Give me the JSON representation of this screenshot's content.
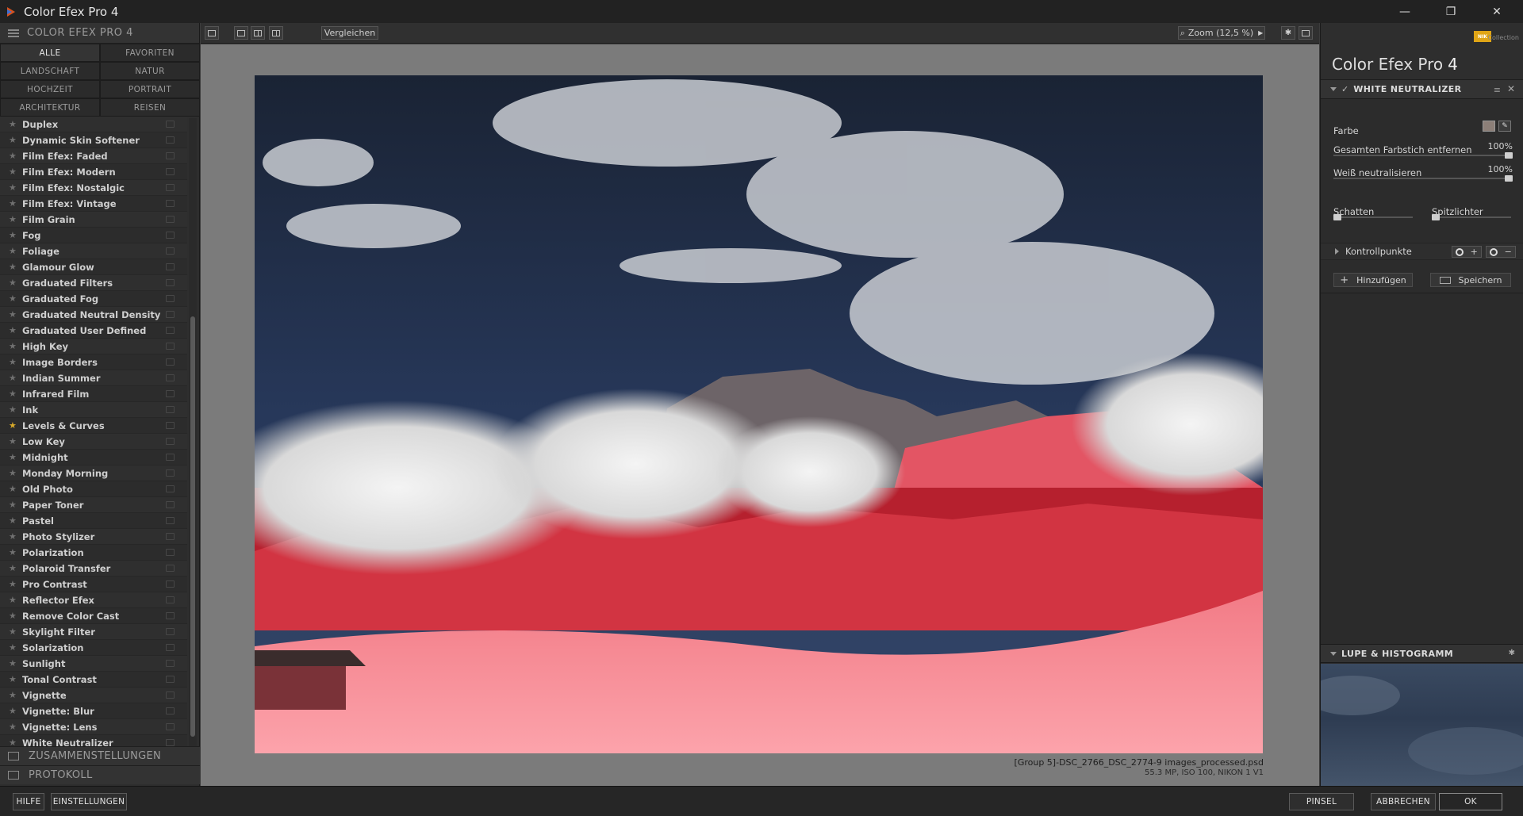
{
  "window": {
    "title": "Color Efex Pro 4",
    "minimize": "—",
    "maximize": "❐",
    "close": "✕"
  },
  "left": {
    "header": "COLOR EFEX PRO 4",
    "categories": [
      {
        "label": "ALLE",
        "active": true
      },
      {
        "label": "FAVORITEN",
        "active": false
      },
      {
        "label": "LANDSCHAFT",
        "active": false
      },
      {
        "label": "NATUR",
        "active": false
      },
      {
        "label": "HOCHZEIT",
        "active": false
      },
      {
        "label": "PORTRAIT",
        "active": false
      },
      {
        "label": "ARCHITEKTUR",
        "active": false
      },
      {
        "label": "REISEN",
        "active": false
      }
    ],
    "filters": [
      {
        "name": "Duplex",
        "fav": false
      },
      {
        "name": "Dynamic Skin Softener",
        "fav": false
      },
      {
        "name": "Film Efex: Faded",
        "fav": false
      },
      {
        "name": "Film Efex: Modern",
        "fav": false
      },
      {
        "name": "Film Efex: Nostalgic",
        "fav": false
      },
      {
        "name": "Film Efex: Vintage",
        "fav": false
      },
      {
        "name": "Film Grain",
        "fav": false
      },
      {
        "name": "Fog",
        "fav": false
      },
      {
        "name": "Foliage",
        "fav": false
      },
      {
        "name": "Glamour Glow",
        "fav": false
      },
      {
        "name": "Graduated Filters",
        "fav": false
      },
      {
        "name": "Graduated Fog",
        "fav": false
      },
      {
        "name": "Graduated Neutral Density",
        "fav": false
      },
      {
        "name": "Graduated User Defined",
        "fav": false
      },
      {
        "name": "High Key",
        "fav": false
      },
      {
        "name": "Image Borders",
        "fav": false
      },
      {
        "name": "Indian Summer",
        "fav": false
      },
      {
        "name": "Infrared Film",
        "fav": false
      },
      {
        "name": "Ink",
        "fav": false
      },
      {
        "name": "Levels & Curves",
        "fav": true
      },
      {
        "name": "Low Key",
        "fav": false
      },
      {
        "name": "Midnight",
        "fav": false
      },
      {
        "name": "Monday Morning",
        "fav": false
      },
      {
        "name": "Old Photo",
        "fav": false
      },
      {
        "name": "Paper Toner",
        "fav": false
      },
      {
        "name": "Pastel",
        "fav": false
      },
      {
        "name": "Photo Stylizer",
        "fav": false
      },
      {
        "name": "Polarization",
        "fav": false
      },
      {
        "name": "Polaroid Transfer",
        "fav": false
      },
      {
        "name": "Pro Contrast",
        "fav": false
      },
      {
        "name": "Reflector Efex",
        "fav": false
      },
      {
        "name": "Remove Color Cast",
        "fav": false
      },
      {
        "name": "Skylight Filter",
        "fav": false
      },
      {
        "name": "Solarization",
        "fav": false
      },
      {
        "name": "Sunlight",
        "fav": false
      },
      {
        "name": "Tonal Contrast",
        "fav": false
      },
      {
        "name": "Vignette",
        "fav": false
      },
      {
        "name": "Vignette: Blur",
        "fav": false
      },
      {
        "name": "Vignette: Lens",
        "fav": false
      },
      {
        "name": "White Neutralizer",
        "fav": false
      }
    ],
    "sections": {
      "recipes": "ZUSAMMENSTELLUNGEN",
      "history": "PROTOKOLL"
    }
  },
  "toolbar": {
    "compare": "Vergleichen",
    "zoom": "Zoom (12,5 %)"
  },
  "file": {
    "name": "[Group 5]-DSC_2766_DSC_2774-9 images_processed.psd",
    "meta": "55.3 MP, ISO 100, NIKON 1 V1"
  },
  "right": {
    "brand_collection": "Collection",
    "brand_logo": "NIK",
    "product": "Color Efex Pro",
    "version": "4",
    "filter": {
      "title": "WHITE NEUTRALIZER",
      "check": "✓",
      "color_label": "Farbe",
      "swatch_color": "#8c7f78",
      "cast_label": "Gesamten Farbstich entfernen",
      "cast_value": "100%",
      "cast_level": 1.0,
      "white_label": "Weiß neutralisieren",
      "white_value": "100%",
      "white_level": 1.0,
      "shadows_label": "Schatten",
      "shadows_level": 0.0,
      "highlights_label": "Spitzlichter",
      "highlights_level": 0.0,
      "controlpoints_label": "Kontrollpunkte"
    },
    "add_label": "Hinzufügen",
    "save_label": "Speichern",
    "loupe_title": "LUPE & HISTOGRAMM"
  },
  "bottom": {
    "help": "HILFE",
    "settings": "EINSTELLUNGEN",
    "brush": "PINSEL",
    "cancel": "ABBRECHEN",
    "ok": "OK"
  }
}
